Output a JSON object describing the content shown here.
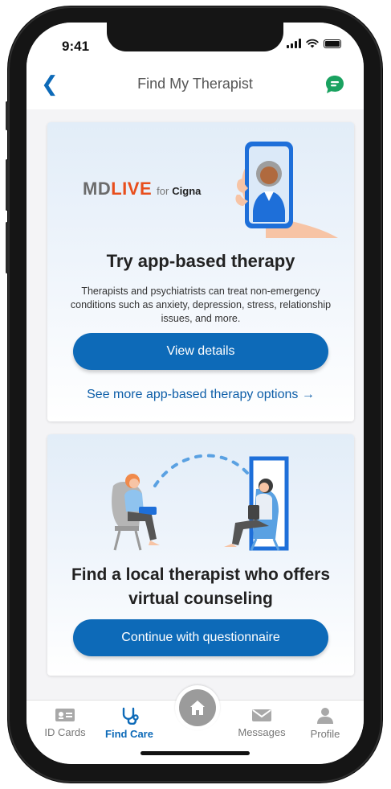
{
  "status_bar": {
    "time": "9:41"
  },
  "header": {
    "back_icon": "chevron-left-icon",
    "title": "Find My Therapist",
    "chat_icon": "chat-bubble-icon"
  },
  "cards": [
    {
      "logo": {
        "md": "MD",
        "live": "LIVE",
        "for": "for",
        "cigna": "Cigna"
      },
      "heading": "Try app-based therapy",
      "body": "Therapists and psychiatrists can treat non-emergency conditions such as anxiety, depression, stress, relationship issues, and more.",
      "button_label": "View details",
      "link_label": "See more app-based therapy options →"
    },
    {
      "heading": "Find a local therapist who offers virtual counseling",
      "button_label": "Continue with questionnaire"
    }
  ],
  "tab_bar": {
    "tabs": [
      {
        "label": "ID Cards",
        "icon": "id-card-icon",
        "active": false
      },
      {
        "label": "Find Care",
        "icon": "stethoscope-icon",
        "active": true
      },
      {
        "label": "Home",
        "icon": "home-icon",
        "active": false
      },
      {
        "label": "Messages",
        "icon": "envelope-icon",
        "active": false
      },
      {
        "label": "Profile",
        "icon": "person-icon",
        "active": false
      }
    ]
  },
  "colors": {
    "primary": "#0d6ab8",
    "link": "#0d5ea8",
    "mdlive_orange": "#e84e1c",
    "chat_green": "#1aa260",
    "tab_inactive": "#9b9b9b"
  }
}
